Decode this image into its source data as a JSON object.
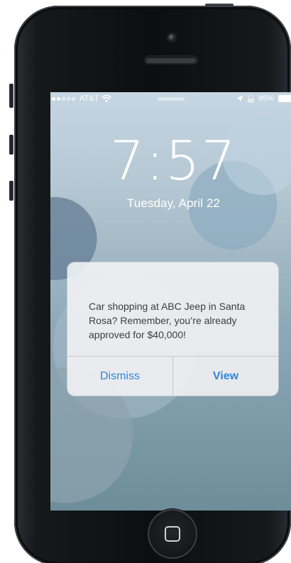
{
  "status_bar": {
    "carrier": "AT&T",
    "battery_percent": "95%"
  },
  "lock_screen": {
    "time": "7:57",
    "date": "Tuesday, April 22"
  },
  "notification": {
    "message": "Car shopping at ABC Jeep in Santa Rosa? Remember, you’re already approved for $40,000!",
    "actions": {
      "dismiss": "Dismiss",
      "view": "View"
    }
  },
  "icons": {
    "wifi": "wifi-icon",
    "location": "location-arrow-icon",
    "lock": "lock-icon",
    "battery": "battery-icon",
    "home": "home-button-icon"
  },
  "colors": {
    "accent_blue": "#2f86d9",
    "notification_bg": "#f2f2f3",
    "screen_bg": "#9bb4c2",
    "phone_body": "#101214"
  }
}
